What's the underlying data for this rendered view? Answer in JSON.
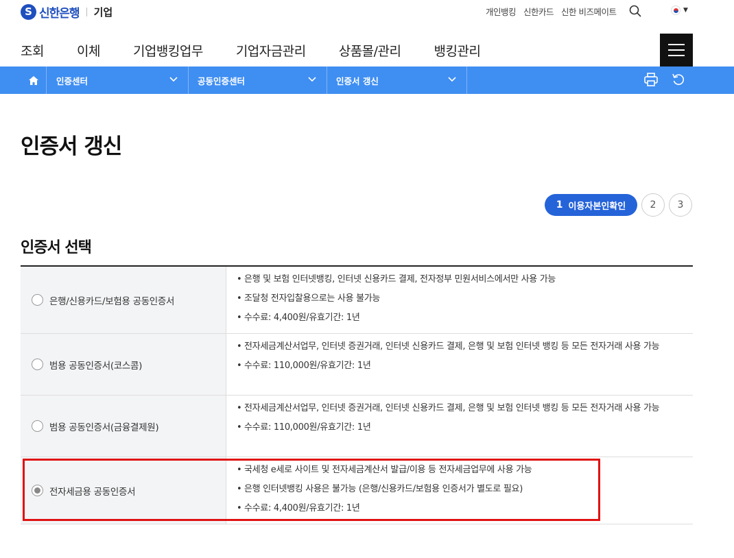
{
  "header": {
    "logo_mark": "S",
    "logo_bank": "신한은행",
    "logo_corp": "기업",
    "util_links": [
      "개인뱅킹",
      "신한카드",
      "신한 비즈메이트"
    ]
  },
  "main_nav": [
    "조회",
    "이체",
    "기업뱅킹업무",
    "기업자금관리",
    "상품몰/관리",
    "뱅킹관리"
  ],
  "breadcrumb": [
    "인증센터",
    "공동인증센터",
    "인증서 갱신"
  ],
  "page": {
    "title": "인증서 갱신",
    "section_title": "인증서 선택"
  },
  "stepper": {
    "active_num": "1",
    "active_label": "이용자본인확인",
    "steps": [
      "2",
      "3"
    ]
  },
  "certificates": [
    {
      "name": "은행/신용카드/보험용 공동인증서",
      "selected": false,
      "details": [
        "은행 및 보험 인터넷뱅킹, 인터넷 신용카드 결제, 전자정부 민원서비스에서만 사용 가능",
        "조달청 전자입찰용으로는 사용 불가능",
        "수수료: 4,400원/유효기간: 1년"
      ]
    },
    {
      "name": "범용 공동인증서(코스콤)",
      "selected": false,
      "details": [
        "전자세금계산서업무, 인터넷 증권거래, 인터넷 신용카드 결제, 은행 및 보험 인터넷 뱅킹 등 모든 전자거래 사용 가능",
        "수수료: 110,000원/유효기간: 1년"
      ]
    },
    {
      "name": "범용 공동인증서(금융결제원)",
      "selected": false,
      "details": [
        "전자세금계산서업무, 인터넷 증권거래, 인터넷 신용카드 결제, 은행 및 보험 인터넷 뱅킹 등 모든 전자거래 사용 가능",
        "수수료: 110,000원/유효기간: 1년"
      ]
    },
    {
      "name": "전자세금용 공동인증서",
      "selected": true,
      "details": [
        "국세청 e세로 사이트 및 전자세금계산서 발급/이용 등 전자세금업무에 사용 가능",
        "은행 인터넷뱅킹 사용은 불가능 (은행/신용카드/보험용 인증서가 별도로 필요)",
        "수수료: 4,400원/유효기간: 1년"
      ]
    }
  ],
  "colors": {
    "brand_blue": "#1e4fbf",
    "crumb_bar": "#3f8ef2",
    "step_active": "#2563d9",
    "highlight": "#e01212"
  },
  "icons": {
    "search": "search-icon",
    "home": "home-icon",
    "print": "print-icon",
    "refresh": "refresh-icon",
    "menu": "hamburger-menu-icon"
  }
}
